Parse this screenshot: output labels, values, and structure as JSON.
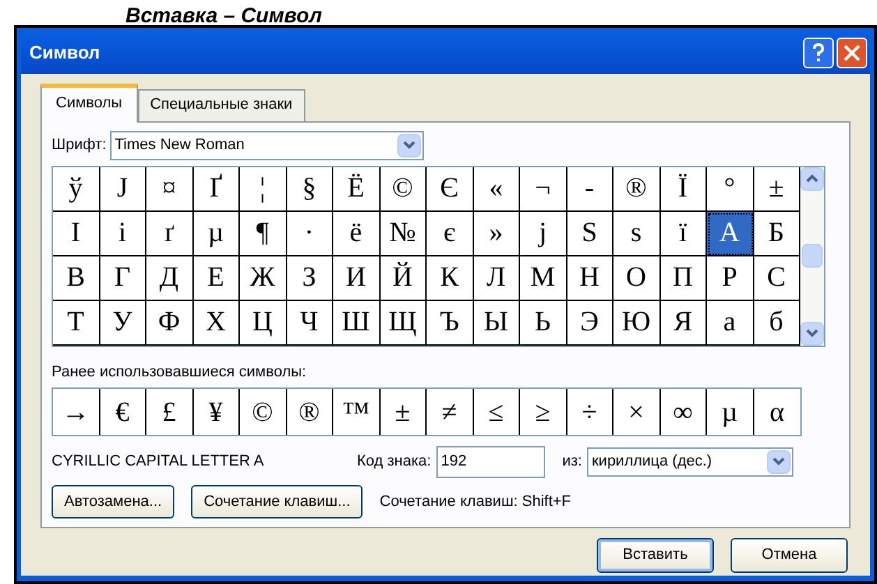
{
  "page_heading": "Вставка – Символ",
  "window": {
    "title": "Символ"
  },
  "tabs": [
    {
      "label": "Символы",
      "selected": true
    },
    {
      "label": "Специальные знаки",
      "selected": false
    }
  ],
  "font": {
    "label": "Шрифт:",
    "value": "Times New Roman"
  },
  "symbol_grid": [
    [
      {
        "char": "ў",
        "selected": false
      },
      {
        "char": "Ј",
        "selected": false
      },
      {
        "char": "¤",
        "selected": false
      },
      {
        "char": "Ґ",
        "selected": false
      },
      {
        "char": "¦",
        "selected": false
      },
      {
        "char": "§",
        "selected": false
      },
      {
        "char": "Ё",
        "selected": false
      },
      {
        "char": "©",
        "selected": false
      },
      {
        "char": "Є",
        "selected": false
      },
      {
        "char": "«",
        "selected": false
      },
      {
        "char": "¬",
        "selected": false
      },
      {
        "char": "-",
        "selected": false
      },
      {
        "char": "®",
        "selected": false
      },
      {
        "char": "Ї",
        "selected": false
      },
      {
        "char": "°",
        "selected": false
      },
      {
        "char": "±",
        "selected": false
      }
    ],
    [
      {
        "char": "І",
        "selected": false
      },
      {
        "char": "і",
        "selected": false
      },
      {
        "char": "ґ",
        "selected": false
      },
      {
        "char": "µ",
        "selected": false
      },
      {
        "char": "¶",
        "selected": false
      },
      {
        "char": "·",
        "selected": false
      },
      {
        "char": "ё",
        "selected": false
      },
      {
        "char": "№",
        "selected": false
      },
      {
        "char": "є",
        "selected": false
      },
      {
        "char": "»",
        "selected": false
      },
      {
        "char": "ј",
        "selected": false
      },
      {
        "char": "Ѕ",
        "selected": false
      },
      {
        "char": "ѕ",
        "selected": false
      },
      {
        "char": "ї",
        "selected": false
      },
      {
        "char": "А",
        "selected": true
      },
      {
        "char": "Б",
        "selected": false
      }
    ],
    [
      {
        "char": "В",
        "selected": false
      },
      {
        "char": "Г",
        "selected": false
      },
      {
        "char": "Д",
        "selected": false
      },
      {
        "char": "Е",
        "selected": false
      },
      {
        "char": "Ж",
        "selected": false
      },
      {
        "char": "З",
        "selected": false
      },
      {
        "char": "И",
        "selected": false
      },
      {
        "char": "Й",
        "selected": false
      },
      {
        "char": "К",
        "selected": false
      },
      {
        "char": "Л",
        "selected": false
      },
      {
        "char": "М",
        "selected": false
      },
      {
        "char": "Н",
        "selected": false
      },
      {
        "char": "О",
        "selected": false
      },
      {
        "char": "П",
        "selected": false
      },
      {
        "char": "Р",
        "selected": false
      },
      {
        "char": "С",
        "selected": false
      }
    ],
    [
      {
        "char": "Т",
        "selected": false
      },
      {
        "char": "У",
        "selected": false
      },
      {
        "char": "Ф",
        "selected": false
      },
      {
        "char": "Х",
        "selected": false
      },
      {
        "char": "Ц",
        "selected": false
      },
      {
        "char": "Ч",
        "selected": false
      },
      {
        "char": "Ш",
        "selected": false
      },
      {
        "char": "Щ",
        "selected": false
      },
      {
        "char": "Ъ",
        "selected": false
      },
      {
        "char": "Ы",
        "selected": false
      },
      {
        "char": "Ь",
        "selected": false
      },
      {
        "char": "Э",
        "selected": false
      },
      {
        "char": "Ю",
        "selected": false
      },
      {
        "char": "Я",
        "selected": false
      },
      {
        "char": "а",
        "selected": false
      },
      {
        "char": "б",
        "selected": false
      }
    ]
  ],
  "recent": {
    "label": "Ранее использовавшиеся символы:",
    "symbols": [
      "→",
      "€",
      "£",
      "¥",
      "©",
      "®",
      "™",
      "±",
      "≠",
      "≤",
      "≥",
      "÷",
      "×",
      "∞",
      "µ",
      "α"
    ]
  },
  "char_name": "CYRILLIC CAPITAL LETTER A",
  "char_code": {
    "label": "Код знака:",
    "value": "192"
  },
  "from": {
    "label": "из:",
    "value": "кириллица (дес.)"
  },
  "buttons": [
    {
      "label": "Автозамена..."
    },
    {
      "label": "Сочетание клавиш..."
    }
  ],
  "shortcut_text": "Сочетание клавиш: Shift+F",
  "footer_buttons": [
    {
      "label": "Вставить",
      "default": true
    },
    {
      "label": "Отмена",
      "default": false
    }
  ]
}
